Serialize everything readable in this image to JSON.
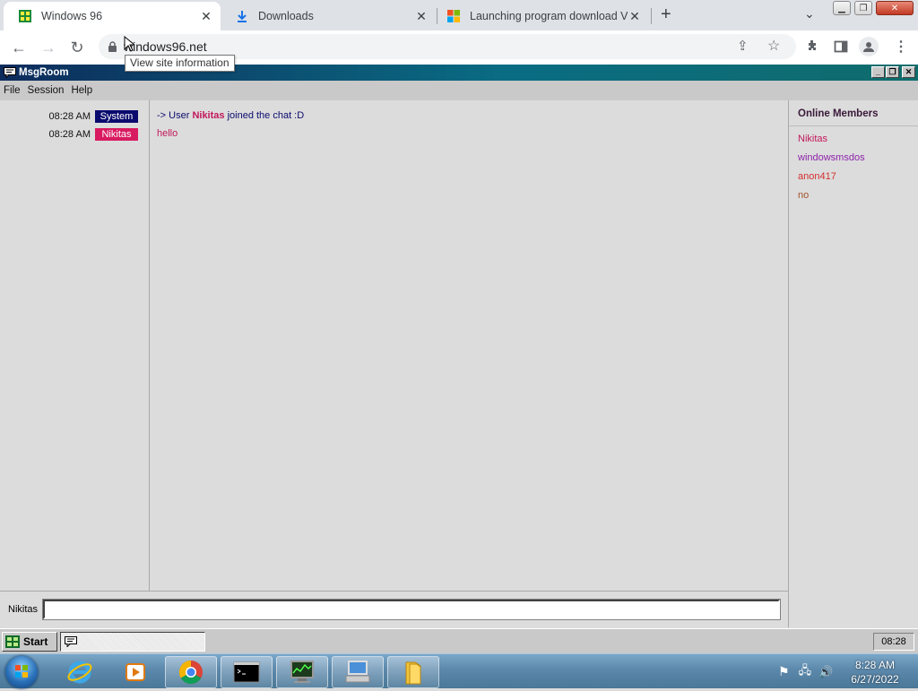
{
  "browser": {
    "tabs": [
      {
        "title": "Windows 96",
        "icon": "windows96-icon",
        "active": true
      },
      {
        "title": "Downloads",
        "icon": "download-icon",
        "active": false
      },
      {
        "title": "Launching program download VI",
        "icon": "microsoft-icon",
        "active": false
      }
    ],
    "url": "windows96.net",
    "tooltip": "View site information"
  },
  "app": {
    "title": "MsgRoom",
    "menu": [
      "File",
      "Session",
      "Help"
    ],
    "messages": [
      {
        "time": "08:28 AM",
        "user": "System",
        "user_color": "#0a0a6e",
        "parts": {
          "prefix": "-> User ",
          "name": "Nikitas",
          "suffix": " joined the chat :D"
        }
      },
      {
        "time": "08:28 AM",
        "user": "Nikitas",
        "user_color": "#d81b60",
        "text": "hello"
      }
    ],
    "members_header": "Online Members",
    "members": [
      {
        "name": "Nikitas",
        "color": "#c2185b"
      },
      {
        "name": "windowsmsdos",
        "color": "#8e24aa"
      },
      {
        "name": "anon417",
        "color": "#d32f2f"
      },
      {
        "name": "no",
        "color": "#a0522d"
      }
    ],
    "input_label": "Nikitas",
    "input_value": ""
  },
  "w96_taskbar": {
    "start_label": "Start",
    "clock": "08:28"
  },
  "win7_taskbar": {
    "time": "8:28 AM",
    "date": "6/27/2022"
  }
}
